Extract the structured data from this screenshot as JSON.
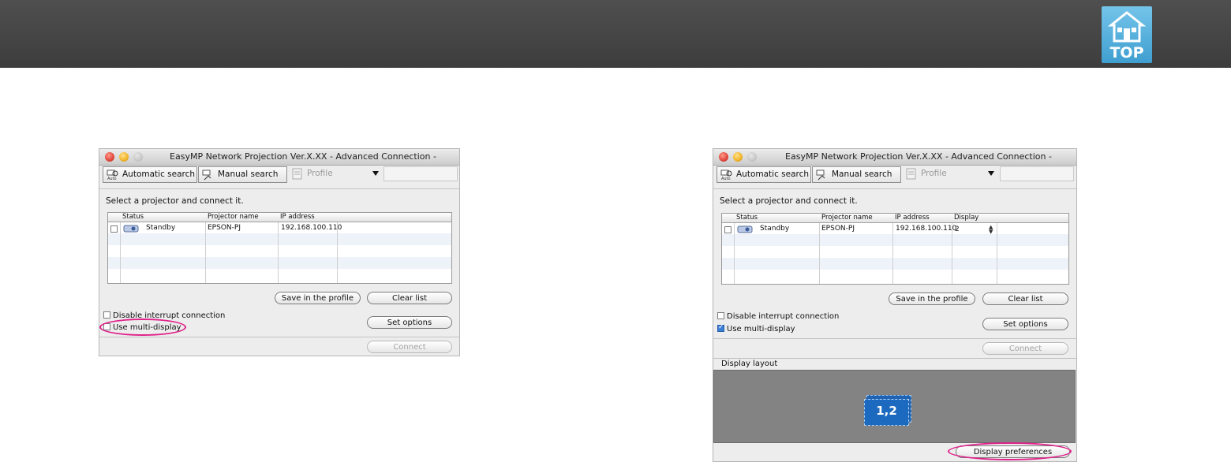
{
  "header": {
    "badge_label": "TOP",
    "badge_icon": "home-icon"
  },
  "windows": [
    {
      "title": "EasyMP Network Projection Ver.X.XX - Advanced Connection -",
      "toolbar": {
        "auto": "Automatic search",
        "manual": "Manual search",
        "profile": "Profile"
      },
      "prompt": "Select a projector and connect it.",
      "columns": {
        "status": "Status",
        "name": "Projector name",
        "ip": "IP address"
      },
      "row": {
        "status": "Standby",
        "name": "EPSON-PJ",
        "ip": "192.168.100.110"
      },
      "buttons": {
        "save": "Save in the profile",
        "clear": "Clear list",
        "options": "Set options",
        "connect": "Connect"
      },
      "checks": {
        "interrupt": "Disable interrupt connection",
        "multi": "Use multi-display"
      }
    },
    {
      "title": "EasyMP Network Projection Ver.X.XX - Advanced Connection -",
      "toolbar": {
        "auto": "Automatic search",
        "manual": "Manual search",
        "profile": "Profile"
      },
      "prompt": "Select a projector and connect it.",
      "columns": {
        "status": "Status",
        "name": "Projector name",
        "ip": "IP address",
        "display": "Display"
      },
      "row": {
        "status": "Standby",
        "name": "EPSON-PJ",
        "ip": "192.168.100.110",
        "display": "2"
      },
      "buttons": {
        "save": "Save in the profile",
        "clear": "Clear list",
        "options": "Set options",
        "connect": "Connect"
      },
      "checks": {
        "interrupt": "Disable interrupt connection",
        "multi": "Use multi-display"
      },
      "layout": {
        "label": "Display layout",
        "monitor": "1,2",
        "prefs": "Display preferences"
      }
    }
  ],
  "colors": {
    "highlight": "#e0218a",
    "monitor": "#1c6ac0",
    "header_bar": "#454545"
  }
}
